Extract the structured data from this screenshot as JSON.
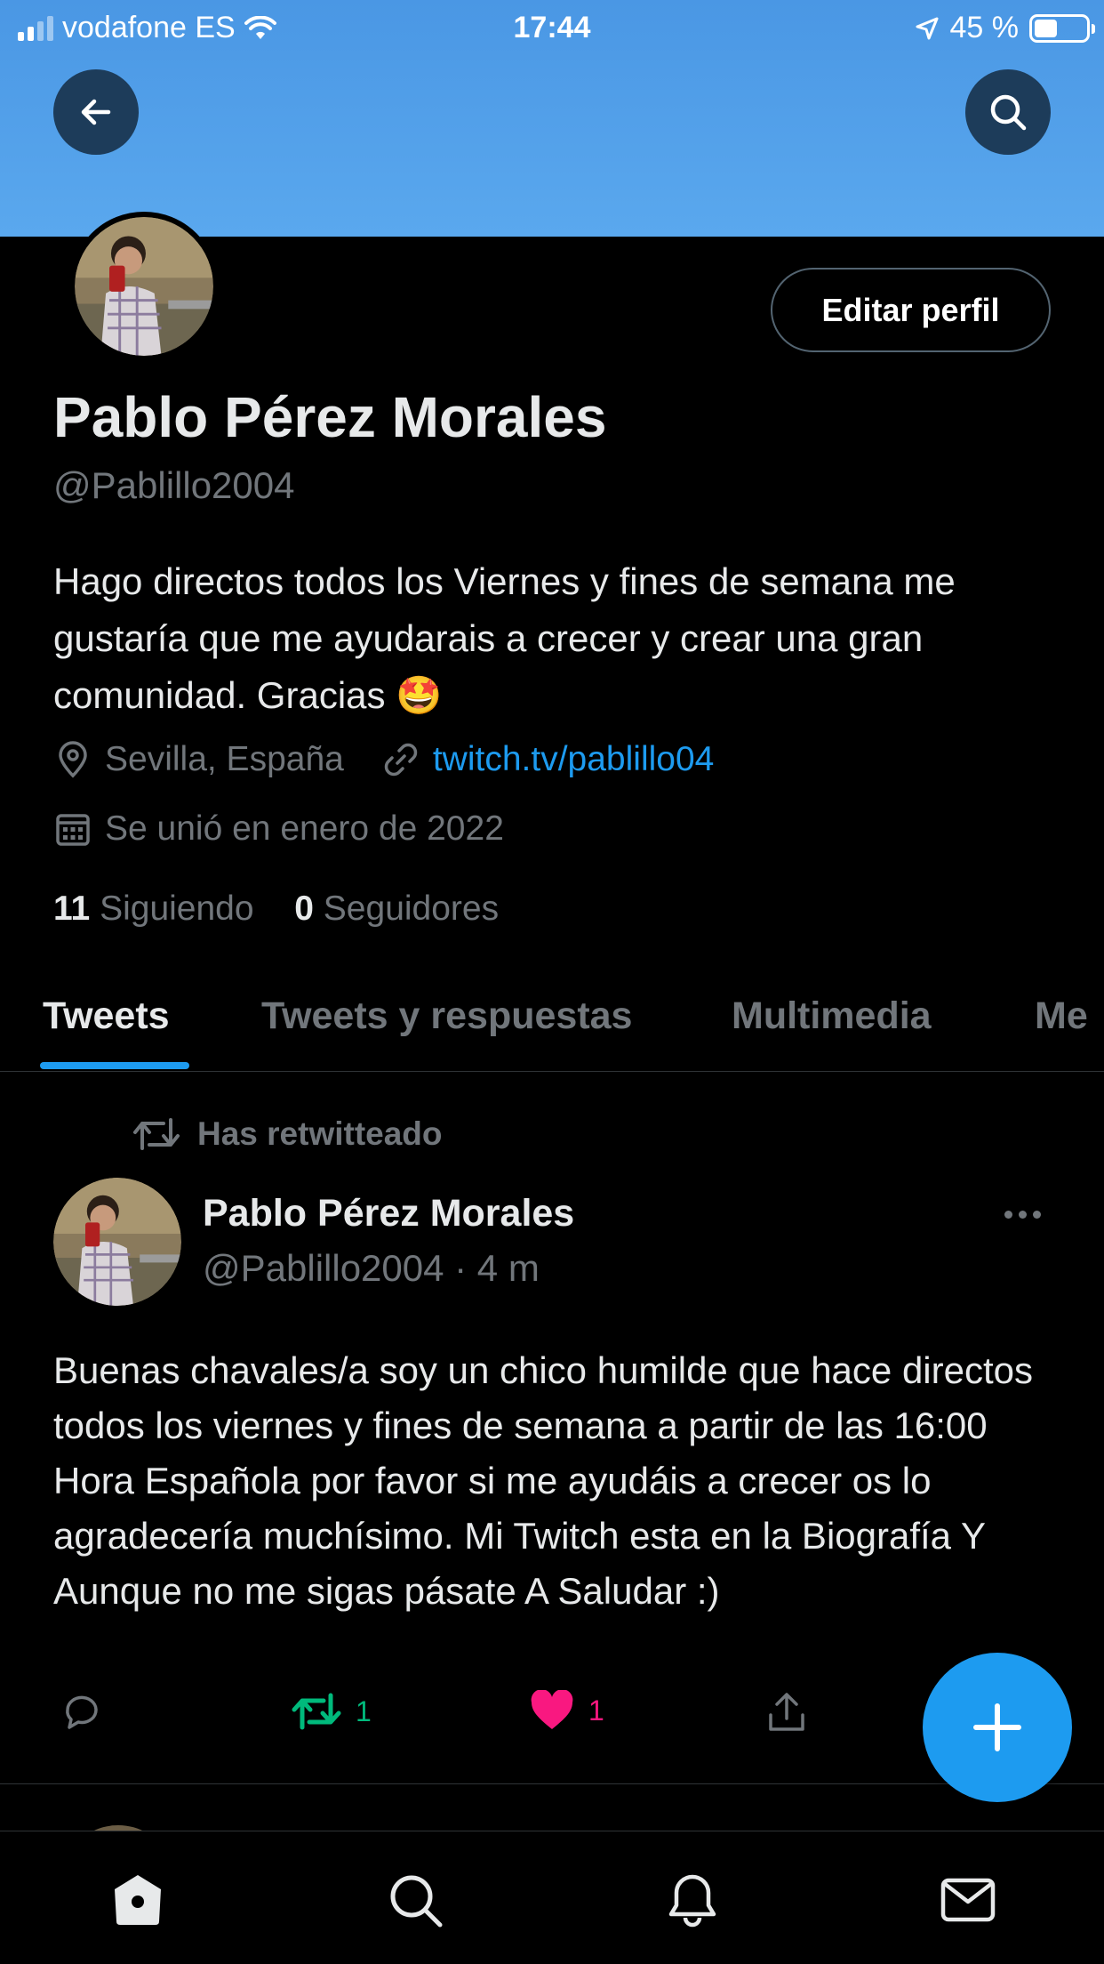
{
  "status_bar": {
    "carrier": "vodafone ES",
    "time": "17:44",
    "battery": "45 %"
  },
  "profile": {
    "edit_label": "Editar perfil",
    "name": "Pablo Pérez Morales",
    "handle": "@Pablillo2004",
    "bio": "Hago directos todos los Viernes y fines de semana me gustaría que me ayudarais a crecer y crear una gran comunidad. Gracias 🤩",
    "location": "Sevilla, España",
    "link": "twitch.tv/pablillo04",
    "joined": "Se unió en enero de 2022",
    "following_count": "11",
    "following_label": "Siguiendo",
    "followers_count": "0",
    "followers_label": "Seguidores"
  },
  "tabs": [
    "Tweets",
    "Tweets y respuestas",
    "Multimedia",
    "Me"
  ],
  "tweet": {
    "retweet_label": "Has retwitteado",
    "name": "Pablo Pérez Morales",
    "handle_time": "@Pablillo2004 · 4 m",
    "text": "Buenas chavales/a soy un chico humilde que hace directos todos los viernes y fines de semana a partir de las 16:00 Hora Española por favor si me ayudáis a crecer os lo agradecería muchísimo. Mi Twitch esta en la Biografía Y Aunque no me sigas pásate A Saludar :)",
    "retweets": "1",
    "likes": "1"
  },
  "colors": {
    "banner": "#4a97e4",
    "accent": "#1d9bf0",
    "retweet": "#00ba7c",
    "like": "#f91880"
  },
  "icons": [
    "back-arrow-icon",
    "search-icon",
    "location-icon",
    "link-icon",
    "calendar-icon",
    "retweet-icon",
    "reply-icon",
    "like-icon",
    "share-icon",
    "compose-icon",
    "home-icon",
    "notifications-icon",
    "messages-icon"
  ]
}
